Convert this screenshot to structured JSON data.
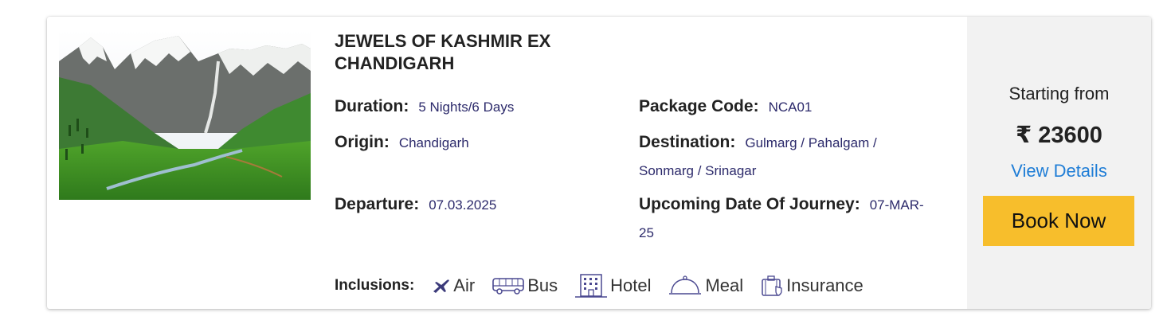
{
  "package": {
    "title": "JEWELS OF KASHMIR EX CHANDIGARH",
    "image_icon": "mountain-valley-photo"
  },
  "details": {
    "duration_label": "Duration:",
    "duration_value": "5 Nights/6 Days",
    "package_code_label": "Package Code:",
    "package_code_value": "NCA01",
    "origin_label": "Origin:",
    "origin_value": "Chandigarh",
    "destination_label": "Destination:",
    "destination_value": "Gulmarg / Pahalgam / Sonmarg / Srinagar",
    "departure_label": "Departure:",
    "departure_value": "07.03.2025",
    "journey_label": "Upcoming Date Of Journey:",
    "journey_value": "07-MAR-25"
  },
  "inclusions": {
    "label": "Inclusions:",
    "items": [
      {
        "text": "Air",
        "icon": "plane-icon"
      },
      {
        "text": "Bus",
        "icon": "bus-icon"
      },
      {
        "text": "Hotel",
        "icon": "hotel-icon"
      },
      {
        "text": "Meal",
        "icon": "meal-cloche-icon"
      },
      {
        "text": "Insurance",
        "icon": "insurance-icon"
      }
    ]
  },
  "pricing": {
    "starting_label": "Starting from",
    "price": "₹ 23600",
    "view_details": "View Details",
    "book_now": "Book Now"
  },
  "colors": {
    "value_text": "#2c2a6b",
    "link": "#1f7dd6",
    "book_button": "#f7be2c",
    "side_panel": "#f2f2f2",
    "icon": "#4a4890"
  }
}
